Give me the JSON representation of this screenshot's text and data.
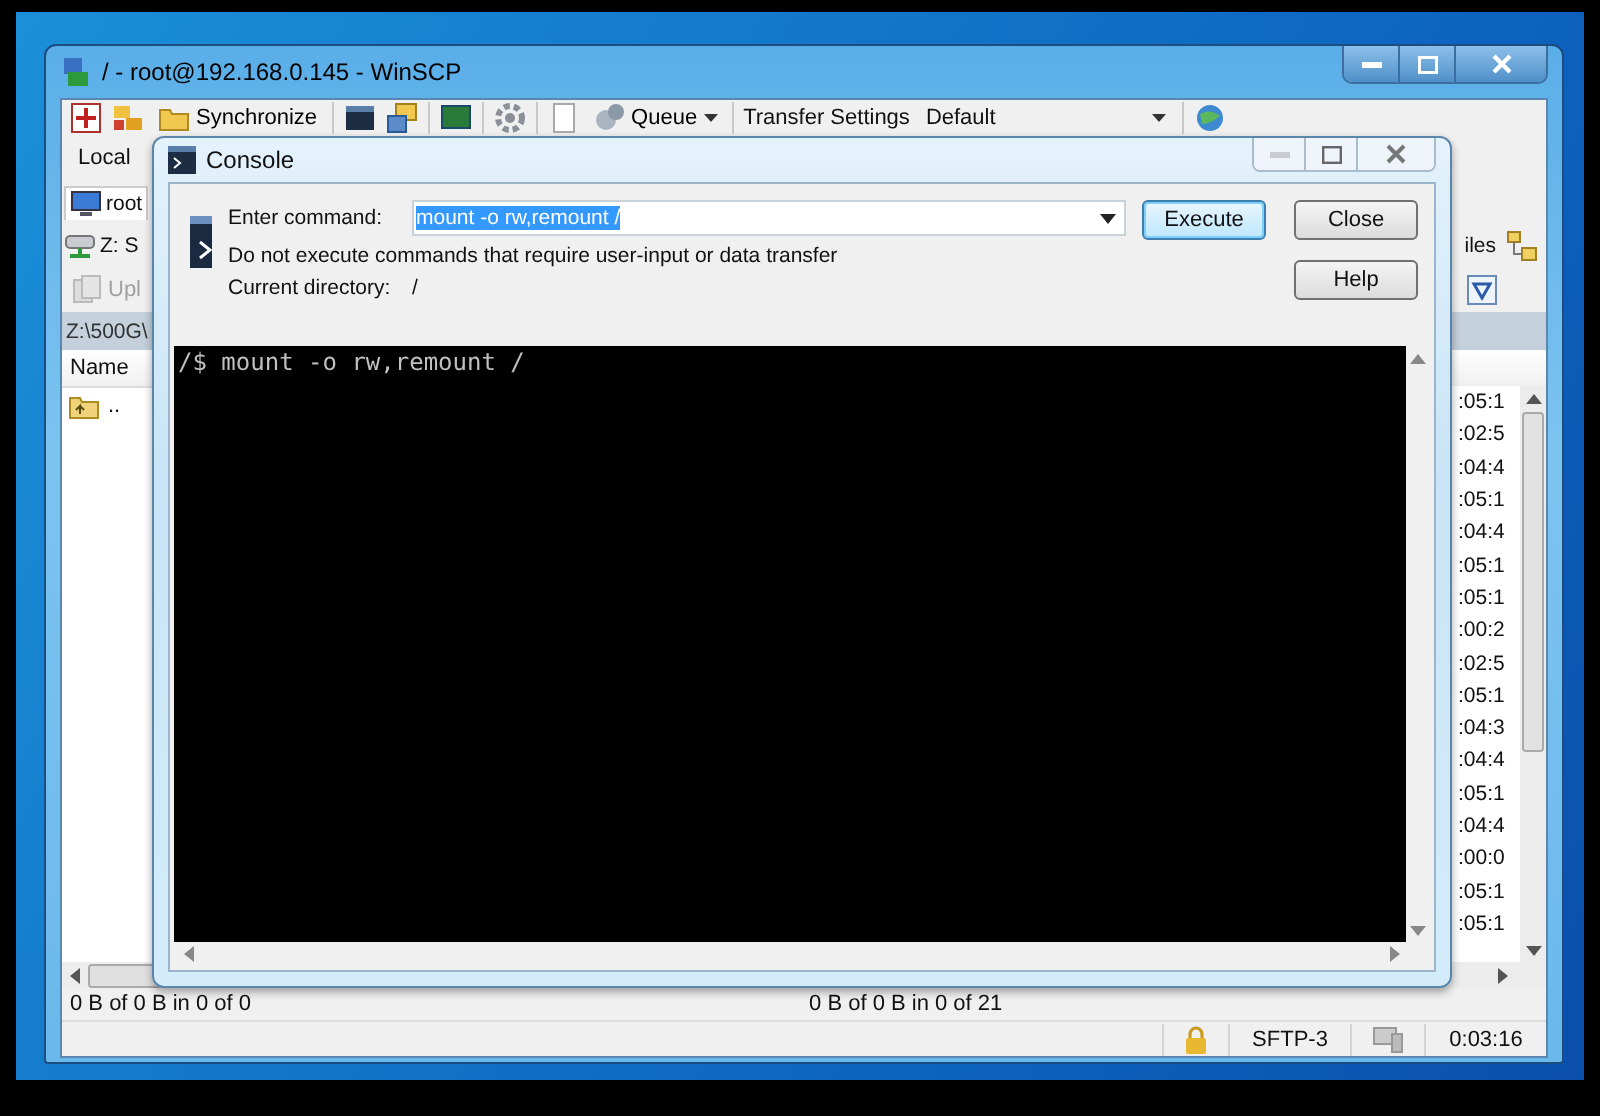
{
  "window": {
    "title": "/ - root@192.168.0.145 - WinSCP"
  },
  "toolbar": {
    "synchronize": "Synchronize",
    "queue": "Queue",
    "transfer_settings": "Transfer Settings",
    "preset": "Default"
  },
  "local_panel": {
    "menu_label": "Local",
    "session_tab": "root",
    "drive": "Z: S",
    "upload_button": {
      "label": "Upl",
      "disabled": true
    },
    "path": "Z:\\500G\\",
    "column_header": "Name",
    "rows": [
      ".."
    ],
    "status": "0 B of 0 B in 0 of 0"
  },
  "remote_panel": {
    "toolbar_label": "iles",
    "times": [
      ":05:1",
      ":02:5",
      ":04:4",
      ":05:1",
      ":04:4",
      ":05:1",
      ":05:1",
      ":00:2",
      ":02:5",
      ":05:1",
      ":04:3",
      ":04:4",
      ":05:1",
      ":04:4",
      ":00:0",
      ":05:1",
      ":05:1"
    ],
    "status": "0 B of 0 B in 0 of 21"
  },
  "status_bar": {
    "protocol": "SFTP-3",
    "elapsed": "0:03:16"
  },
  "console": {
    "title": "Console",
    "command_label": "Enter command:",
    "command": "mount -o rw,remount /",
    "command_selected": true,
    "warning": "Do not execute commands that require user-input or data transfer",
    "directory_label": "Current directory:",
    "directory": "/",
    "buttons": [
      {
        "label": "Execute",
        "default": true
      },
      {
        "label": "Close",
        "default": false
      },
      {
        "label": "Help",
        "default": false
      }
    ],
    "output": [
      "/$ mount -o rw,remount /"
    ]
  }
}
